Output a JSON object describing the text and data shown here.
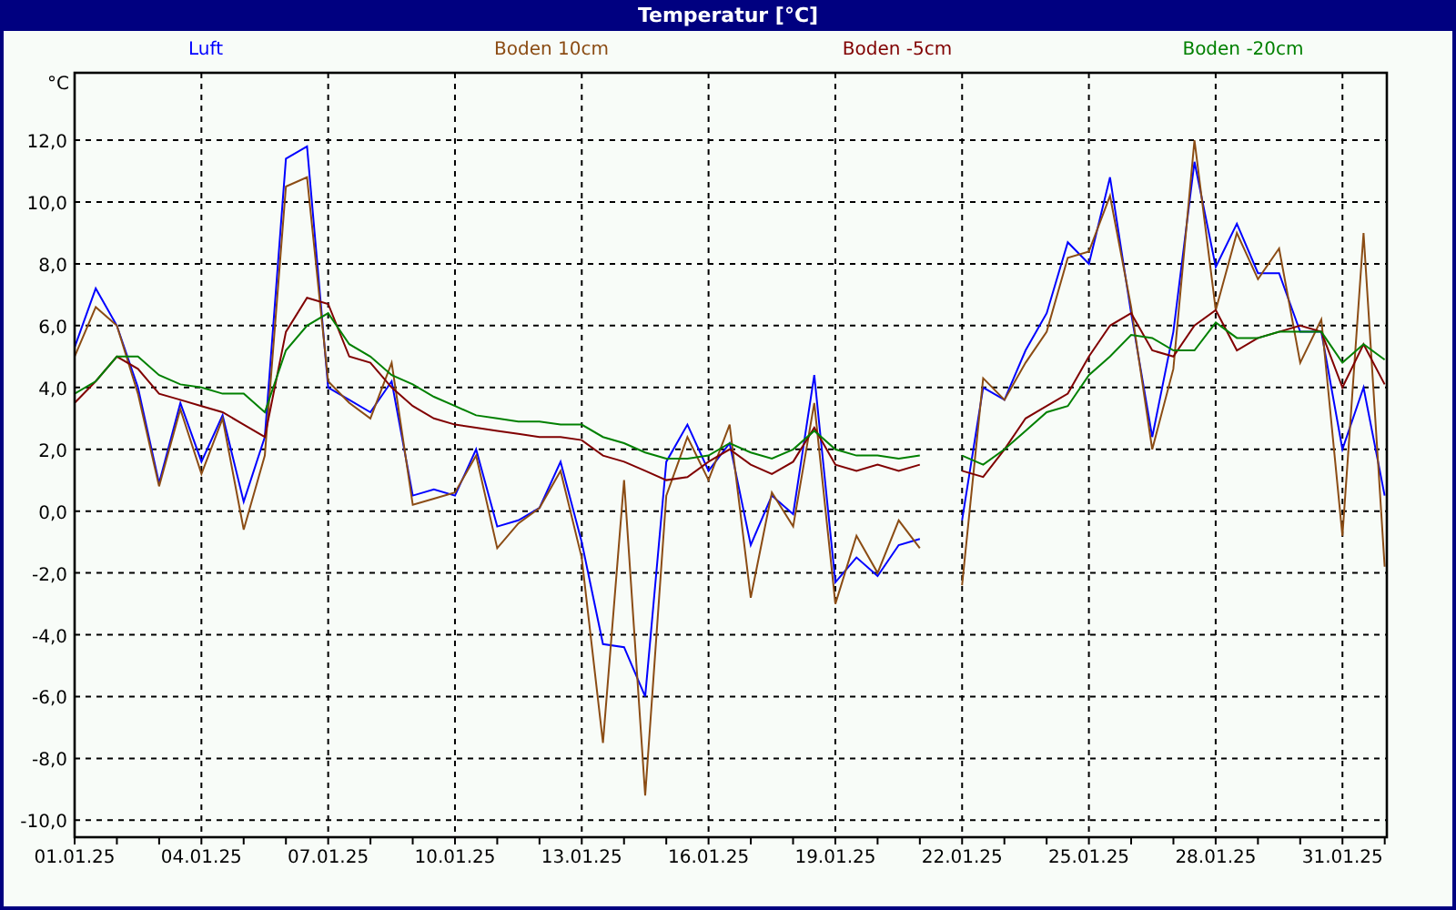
{
  "window": {
    "title": "Temperatur [°C]"
  },
  "chart": {
    "chart_data": {
      "type": "line",
      "ylabel": "°C",
      "categories": [
        "01.01.25",
        null,
        null,
        null,
        null,
        null,
        "04.01.25",
        null,
        null,
        null,
        null,
        null,
        "07.01.25",
        null,
        null,
        null,
        null,
        null,
        "10.01.25",
        null,
        null,
        null,
        null,
        null,
        "13.01.25",
        null,
        null,
        null,
        null,
        null,
        "16.01.25",
        null,
        null,
        null,
        null,
        null,
        "19.01.25",
        null,
        null,
        null,
        null,
        null,
        "22.01.25",
        null,
        null,
        null,
        null,
        null,
        "25.01.25",
        null,
        null,
        null,
        null,
        null,
        "28.01.25",
        null,
        null,
        null,
        null,
        null,
        "31.01.25",
        null,
        null
      ],
      "series": [
        {
          "name": "Luft",
          "color": "#0000ff",
          "values": [
            5.3,
            7.2,
            6.0,
            4.0,
            0.9,
            3.5,
            1.6,
            3.1,
            0.3,
            2.4,
            11.4,
            11.8,
            4.0,
            3.6,
            3.2,
            4.2,
            0.5,
            0.7,
            0.5,
            2.0,
            -0.5,
            -0.3,
            0.1,
            1.6,
            -1.0,
            -4.3,
            -4.4,
            -6.0,
            1.6,
            2.8,
            1.3,
            2.2,
            -1.1,
            0.5,
            -0.1,
            4.4,
            -2.3,
            -1.5,
            -2.1,
            -1.1,
            -0.9,
            null,
            -0.3,
            4.0,
            3.6,
            5.2,
            6.4,
            8.7,
            8.0,
            10.8,
            6.4,
            2.4,
            5.8,
            11.3,
            7.9,
            9.3,
            7.7,
            7.7,
            5.8,
            5.8,
            2.0,
            4.0,
            0.5
          ]
        },
        {
          "name": "Boden 10cm",
          "color": "#8b4c14",
          "values": [
            5.0,
            6.6,
            6.0,
            3.8,
            0.8,
            3.3,
            1.2,
            3.0,
            -0.6,
            1.8,
            10.5,
            10.8,
            4.2,
            3.5,
            3.0,
            4.8,
            0.2,
            0.4,
            0.6,
            1.8,
            -1.2,
            -0.4,
            0.1,
            1.3,
            -1.5,
            -7.5,
            1.0,
            -9.2,
            0.5,
            2.4,
            1.0,
            2.8,
            -2.8,
            0.6,
            -0.5,
            3.5,
            -3.0,
            -0.8,
            -2.0,
            -0.3,
            -1.2,
            null,
            -2.4,
            4.3,
            3.6,
            4.8,
            5.8,
            8.2,
            8.4,
            10.2,
            6.6,
            2.0,
            4.6,
            12.0,
            6.5,
            9.0,
            7.5,
            8.5,
            4.8,
            6.2,
            -0.8,
            9.0,
            -1.8
          ]
        },
        {
          "name": "Boden -5cm",
          "color": "#800000",
          "values": [
            3.5,
            4.2,
            5.0,
            4.6,
            3.8,
            3.6,
            3.4,
            3.2,
            2.8,
            2.4,
            5.8,
            6.9,
            6.7,
            5.0,
            4.8,
            4.0,
            3.4,
            3.0,
            2.8,
            2.7,
            2.6,
            2.5,
            2.4,
            2.4,
            2.3,
            1.8,
            1.6,
            1.3,
            1.0,
            1.1,
            1.6,
            2.0,
            1.5,
            1.2,
            1.6,
            2.7,
            1.5,
            1.3,
            1.5,
            1.3,
            1.5,
            null,
            1.3,
            1.1,
            2.0,
            3.0,
            3.4,
            3.8,
            5.0,
            6.0,
            6.4,
            5.2,
            5.0,
            6.0,
            6.5,
            5.2,
            5.6,
            5.8,
            6.0,
            5.8,
            4.0,
            5.4,
            4.1
          ]
        },
        {
          "name": "Boden -20cm",
          "color": "#008000",
          "values": [
            3.8,
            4.2,
            5.0,
            5.0,
            4.4,
            4.1,
            4.0,
            3.8,
            3.8,
            3.2,
            5.2,
            6.0,
            6.4,
            5.4,
            5.0,
            4.4,
            4.1,
            3.7,
            3.4,
            3.1,
            3.0,
            2.9,
            2.9,
            2.8,
            2.8,
            2.4,
            2.2,
            1.9,
            1.7,
            1.7,
            1.8,
            2.2,
            1.9,
            1.7,
            2.0,
            2.6,
            2.0,
            1.8,
            1.8,
            1.7,
            1.8,
            null,
            1.8,
            1.5,
            2.0,
            2.6,
            3.2,
            3.4,
            4.4,
            5.0,
            5.7,
            5.6,
            5.2,
            5.2,
            6.1,
            5.6,
            5.6,
            5.8,
            5.8,
            5.8,
            4.8,
            5.4,
            4.9
          ]
        }
      ],
      "ylim": [
        -10.55,
        14.18
      ],
      "grid": true,
      "yticks": [
        {
          "value": -10,
          "label": "-10,0"
        },
        {
          "value": -8,
          "label": "-8,0"
        },
        {
          "value": -6,
          "label": "-6,0"
        },
        {
          "value": -4,
          "label": "-4,0"
        },
        {
          "value": -2,
          "label": "-2,0"
        },
        {
          "value": 0,
          "label": "0,0"
        },
        {
          "value": 2,
          "label": "2,0"
        },
        {
          "value": 4,
          "label": "4,0"
        },
        {
          "value": 6,
          "label": "6,0"
        },
        {
          "value": 8,
          "label": "8,0"
        },
        {
          "value": 10,
          "label": "10,0"
        },
        {
          "value": 12,
          "label": "12,0"
        }
      ]
    }
  }
}
